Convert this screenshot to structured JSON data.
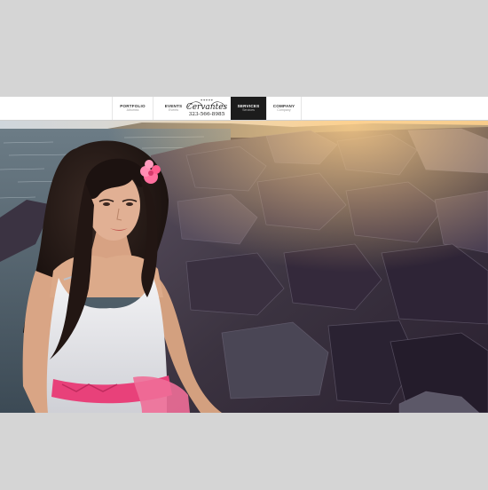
{
  "nav": {
    "items": [
      {
        "label": "PORTFOLIO",
        "sub": "Albumss"
      },
      {
        "label": "EVENTS",
        "sub": "Events"
      },
      {
        "label": "SERVICES",
        "sub": "Services"
      },
      {
        "label": "COMPANY",
        "sub": "Company"
      }
    ],
    "active": "SERVICES"
  },
  "logo": {
    "name": "Cervantes",
    "phone": "323-566-8985"
  },
  "colors": {
    "nav_active_bg": "#1c1c1c",
    "page_bg": "#d5d5d5",
    "accent_pink": "#e8417a"
  }
}
